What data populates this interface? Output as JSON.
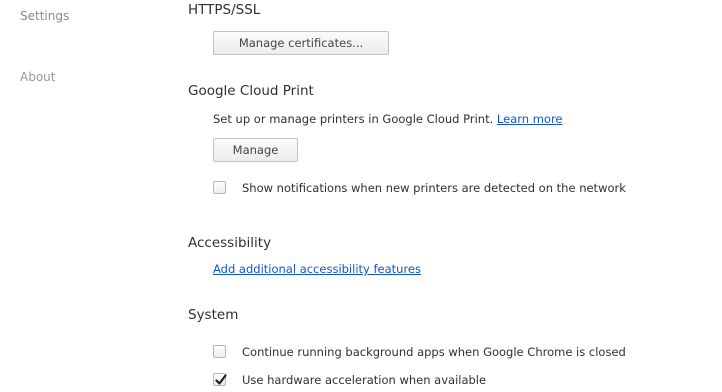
{
  "sidebar": {
    "items": [
      {
        "label": "Settings"
      },
      {
        "label": "About"
      }
    ]
  },
  "https": {
    "title": "HTTPS/SSL",
    "manage_certificates_label": "Manage certificates..."
  },
  "cloud_print": {
    "title": "Google Cloud Print",
    "description": "Set up or manage printers in Google Cloud Print.",
    "learn_more_label": "Learn more",
    "manage_label": "Manage",
    "notify_label": "Show notifications when new printers are detected on the network",
    "notify_checked": false
  },
  "accessibility": {
    "title": "Accessibility",
    "add_features_label": "Add additional accessibility features"
  },
  "system": {
    "title": "System",
    "background_apps_label": "Continue running background apps when Google Chrome is closed",
    "background_apps_checked": false,
    "hw_accel_label": "Use hardware acceleration when available",
    "hw_accel_checked": true
  },
  "colors": {
    "link": "#1155cc",
    "text": "#303030",
    "nav_text": "#999999"
  }
}
